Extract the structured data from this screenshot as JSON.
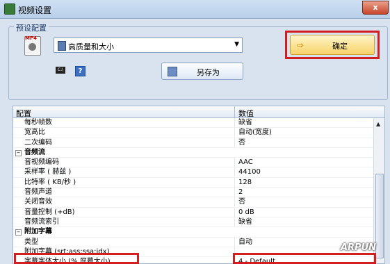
{
  "window": {
    "title": "视频设置",
    "close_label": "x"
  },
  "preset": {
    "group_label": "预设配置",
    "mp4_badge": "MP4",
    "selected": "高质量和大小",
    "cmd_icon": "C:\\",
    "help_icon": "?",
    "save_as_label": "另存为",
    "ok_label": "确定"
  },
  "grid": {
    "header": {
      "name": "配置",
      "value": "数值"
    },
    "rows": [
      {
        "type": "prop",
        "name": "每秒帧数",
        "value": "缺省"
      },
      {
        "type": "prop",
        "name": "宽高比",
        "value": "自动(宽度)"
      },
      {
        "type": "prop",
        "name": "二次编码",
        "value": "否"
      },
      {
        "type": "cat",
        "name": "音频流"
      },
      {
        "type": "prop",
        "name": "音视频编码",
        "value": "AAC"
      },
      {
        "type": "prop",
        "name": "采样率 ( 赫兹 )",
        "value": "44100"
      },
      {
        "type": "prop",
        "name": "比特率 ( KB/秒 )",
        "value": "128"
      },
      {
        "type": "prop",
        "name": "音频声道",
        "value": "2"
      },
      {
        "type": "prop",
        "name": "关闭音效",
        "value": "否"
      },
      {
        "type": "prop",
        "name": "音量控制 (+dB)",
        "value": "0 dB"
      },
      {
        "type": "prop",
        "name": "音频流索引",
        "value": "缺省"
      },
      {
        "type": "cat",
        "name": "附加字幕"
      },
      {
        "type": "prop",
        "name": "类型",
        "value": "自动"
      },
      {
        "type": "prop",
        "name": "附加字幕 (srt;ass;ssa;idx)",
        "value": ""
      },
      {
        "type": "prop",
        "name": "字幕字体大小 (% 屏幕大小)",
        "value": "4 - Default"
      }
    ]
  },
  "watermark": "ARPUN",
  "colors": {
    "highlight": "#d21e1e",
    "ok_button": "#f7d36a"
  }
}
